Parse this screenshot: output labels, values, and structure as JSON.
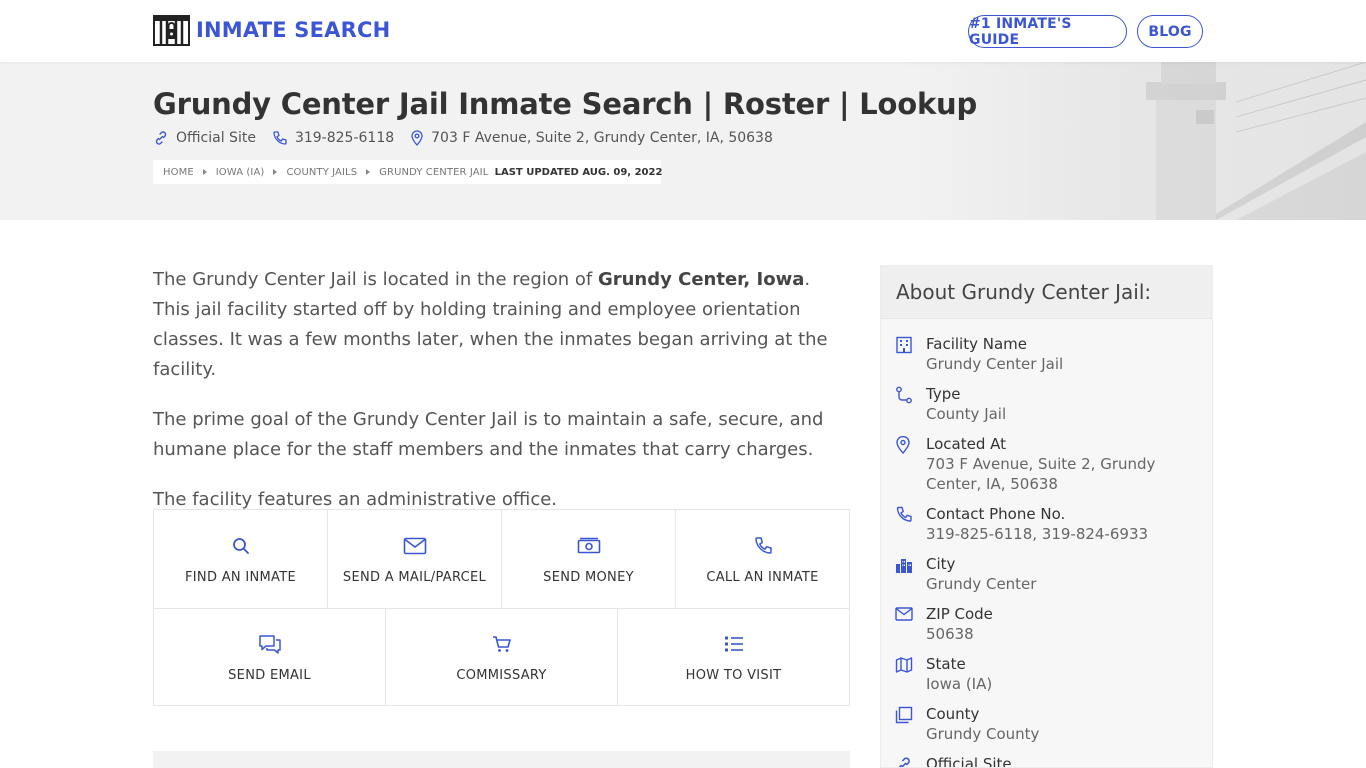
{
  "nav": {
    "logo_text": "INMATE SEARCH",
    "guide_label": "#1 INMATE'S GUIDE",
    "blog_label": "BLOG"
  },
  "hero": {
    "title": "Grundy Center Jail Inmate Search | Roster | Lookup",
    "official_site": "Official Site",
    "phone": "319-825-6118",
    "address": "703 F Avenue, Suite 2, Grundy Center, IA, 50638",
    "breadcrumbs": [
      "HOME",
      "IOWA (IA)",
      "COUNTY JAILS",
      "GRUNDY CENTER JAIL"
    ],
    "last_updated": "LAST UPDATED AUG. 09, 2022"
  },
  "intro": {
    "p1_before": "The Grundy Center Jail is located in the region of ",
    "p1_bold": "Grundy Center, Iowa",
    "p1_after": ". This jail facility started off by holding training and employee orientation classes. It was a few months later, when the inmates began arriving at the facility.",
    "p2": "The prime goal of the Grundy Center Jail is to maintain a safe, secure, and humane place for the staff members and the inmates that carry charges.",
    "p3": "The facility features an administrative office."
  },
  "services": {
    "row1": [
      "FIND AN INMATE",
      "SEND A MAIL/PARCEL",
      "SEND MONEY",
      "CALL AN INMATE"
    ],
    "row2": [
      "SEND EMAIL",
      "COMMISSARY",
      "HOW TO VISIT"
    ]
  },
  "sidebar": {
    "title": "About Grundy Center Jail:",
    "facts": [
      {
        "label": "Facility Name",
        "value": "Grundy Center Jail",
        "icon": "building-icon"
      },
      {
        "label": "Type",
        "value": "County Jail",
        "icon": "route-icon"
      },
      {
        "label": "Located At",
        "value": "703 F Avenue, Suite 2, Grundy Center, IA, 50638",
        "icon": "map-pin-icon"
      },
      {
        "label": "Contact Phone No.",
        "value": "319-825-6118, 319-824-6933",
        "icon": "phone-icon"
      },
      {
        "label": "City",
        "value": "Grundy Center",
        "icon": "city-icon"
      },
      {
        "label": "ZIP Code",
        "value": "50638",
        "icon": "mail-icon"
      },
      {
        "label": "State",
        "value": "Iowa (IA)",
        "icon": "map-icon"
      },
      {
        "label": "County",
        "value": "Grundy County",
        "icon": "copy-icon"
      },
      {
        "label": "Official Site",
        "value": "",
        "icon": "link-icon"
      }
    ]
  },
  "colors": {
    "accent": "#3a56d4",
    "hero_bg": "#f2f2f2",
    "text": "#555555"
  }
}
